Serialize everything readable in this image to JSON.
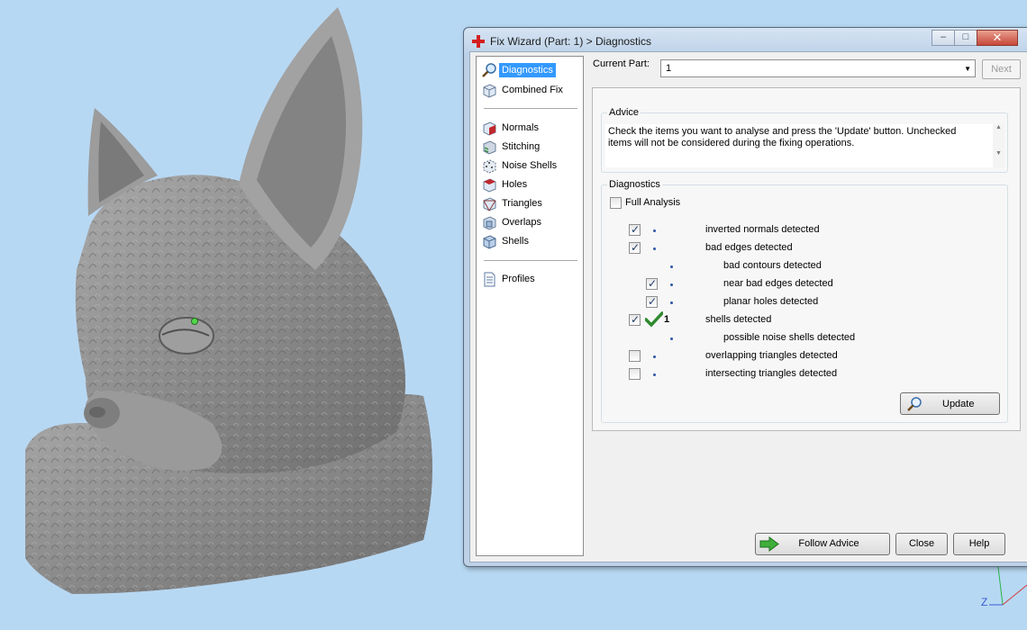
{
  "window": {
    "title": "Fix Wizard (Part: 1) > Diagnostics",
    "minimize": "–",
    "maximize": "□",
    "close": "✕"
  },
  "nav": {
    "items": [
      {
        "label": "Diagnostics",
        "icon": "magnifier-icon",
        "selected": true
      },
      {
        "label": "Combined Fix",
        "icon": "cube-icon"
      },
      {
        "label": "Normals",
        "icon": "cube-red-face-icon"
      },
      {
        "label": "Stitching",
        "icon": "cube-stitch-icon"
      },
      {
        "label": "Noise Shells",
        "icon": "dotted-cube-icon"
      },
      {
        "label": "Holes",
        "icon": "cube-red-hole-icon"
      },
      {
        "label": "Triangles",
        "icon": "triangle-cube-icon"
      },
      {
        "label": "Overlaps",
        "icon": "overlap-cube-icon"
      },
      {
        "label": "Shells",
        "icon": "shells-cube-icon"
      },
      {
        "label": "Profiles",
        "icon": "document-icon"
      }
    ]
  },
  "current_part": {
    "label": "Current Part:",
    "value": "1",
    "next_label": "Next"
  },
  "advice": {
    "title": "Advice",
    "text_line1": "Check the items you want to analyse and press the 'Update' button. Unchecked",
    "text_line2": "items will not be considered during the fixing operations."
  },
  "diagnostics": {
    "title": "Diagnostics",
    "full_analysis_label": "Full Analysis",
    "full_analysis_checked": false,
    "rows": [
      {
        "label": "inverted normals detected",
        "checked": true,
        "result": ""
      },
      {
        "label": "bad edges detected",
        "checked": true,
        "result": ""
      },
      {
        "label": "bad contours detected",
        "checked": null,
        "result": ""
      },
      {
        "label": "near bad edges detected",
        "checked": true,
        "result": ""
      },
      {
        "label": "planar holes detected",
        "checked": true,
        "result": ""
      },
      {
        "label": "shells detected",
        "checked": true,
        "result": "1"
      },
      {
        "label": "possible noise shells detected",
        "checked": null,
        "result": ""
      },
      {
        "label": "overlapping triangles detected",
        "checked": false,
        "result": ""
      },
      {
        "label": "intersecting triangles detected",
        "checked": false,
        "result": ""
      }
    ],
    "update_label": "Update"
  },
  "footer": {
    "follow_advice": "Follow Advice",
    "close": "Close",
    "help": "Help"
  },
  "axis": {
    "z_label": "Z"
  },
  "colors": {
    "background": "#b7d8f3",
    "selection": "#3399ff",
    "model": "#8e8e8e"
  }
}
